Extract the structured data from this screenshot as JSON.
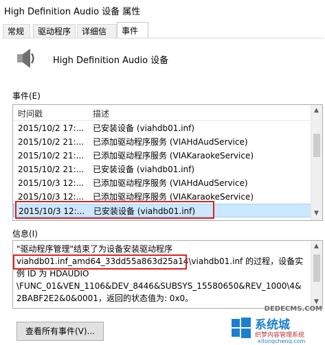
{
  "window": {
    "title": "High Definition Audio 设备 属性"
  },
  "tabs": [
    {
      "label": "常规"
    },
    {
      "label": "驱动程序"
    },
    {
      "label": "详细信息"
    },
    {
      "label": "事件"
    }
  ],
  "device": {
    "name": "High Definition Audio 设备",
    "icon": "speaker-icon"
  },
  "events": {
    "label": "事件(E)",
    "columns": [
      "时间戳",
      "描述"
    ],
    "rows": [
      {
        "time": "2015/10/2 17:...",
        "desc": "已安装设备 (viahdb01.inf)"
      },
      {
        "time": "2015/10/2 21:...",
        "desc": "已添加驱动程序服务 (VIAHdAudService)"
      },
      {
        "time": "2015/10/2 21:...",
        "desc": "已添加驱动程序服务 (VIAKaraokeService)"
      },
      {
        "time": "2015/10/2 21:...",
        "desc": "已安装设备 (viahdb01.inf)"
      },
      {
        "time": "2015/10/3 12:...",
        "desc": "已添加驱动程序服务 (VIAHdAudService)"
      },
      {
        "time": "2015/10/3 12:...",
        "desc": "已添加驱动程序服务 (VIAKaraokeService)"
      },
      {
        "time": "2015/10/3 12:...",
        "desc": "已安装设备 (viahdb01.inf)"
      }
    ],
    "selected_index": 6
  },
  "info": {
    "label": "信息(I)",
    "line1": "\"驱动程序管理\"结束了为设备安装驱动程序",
    "line2_highlight": "viahdb01.inf_amd64_33dd55a863d25a14",
    "line2_rest": "\\viahdb01.inf 的过程，设备实",
    "line3": "例 ID 为 HDAUDIO",
    "line4": "\\FUNC_01&VEN_1106&DEV_8446&SUBSYS_15580650&REV_1000\\4&",
    "line5": "2BABF2E2&0&0001，返回的状态值为: 0x0。"
  },
  "buttons": {
    "view_all": "查看所有事件(V)..."
  },
  "watermark": {
    "brand": "系统城",
    "domain": "DEDECMS.COM",
    "sub": "织梦内容管理系统",
    "url": "xitongcheng.com"
  },
  "colors": {
    "selection": "#cce8ff",
    "highlight_border": "#e02020",
    "watermark_blue": "#1a7fd0"
  }
}
